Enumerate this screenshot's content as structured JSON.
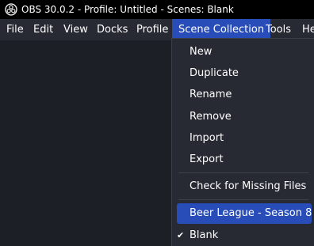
{
  "window": {
    "title": "OBS 30.0.2 - Profile: Untitled - Scenes: Blank"
  },
  "menubar": {
    "items": [
      {
        "label": "File"
      },
      {
        "label": "Edit"
      },
      {
        "label": "View"
      },
      {
        "label": "Docks"
      },
      {
        "label": "Profile"
      },
      {
        "label": "Scene Collection",
        "active": true
      },
      {
        "label": "Tools"
      },
      {
        "label": "He"
      }
    ]
  },
  "scene_collection_menu": {
    "new_label": "New",
    "duplicate_label": "Duplicate",
    "rename_label": "Rename",
    "remove_label": "Remove",
    "import_label": "Import",
    "export_label": "Export",
    "check_missing_label": "Check for Missing Files",
    "collections": [
      {
        "label": "Beer League - Season 8",
        "highlighted": true,
        "checked": false
      },
      {
        "label": "Blank",
        "highlighted": false,
        "checked": true
      }
    ],
    "check_glyph": "✔"
  },
  "colors": {
    "accent": "#284cb8",
    "titlebar": "#000000",
    "menubar": "#272a33",
    "background": "#1d1f26"
  }
}
